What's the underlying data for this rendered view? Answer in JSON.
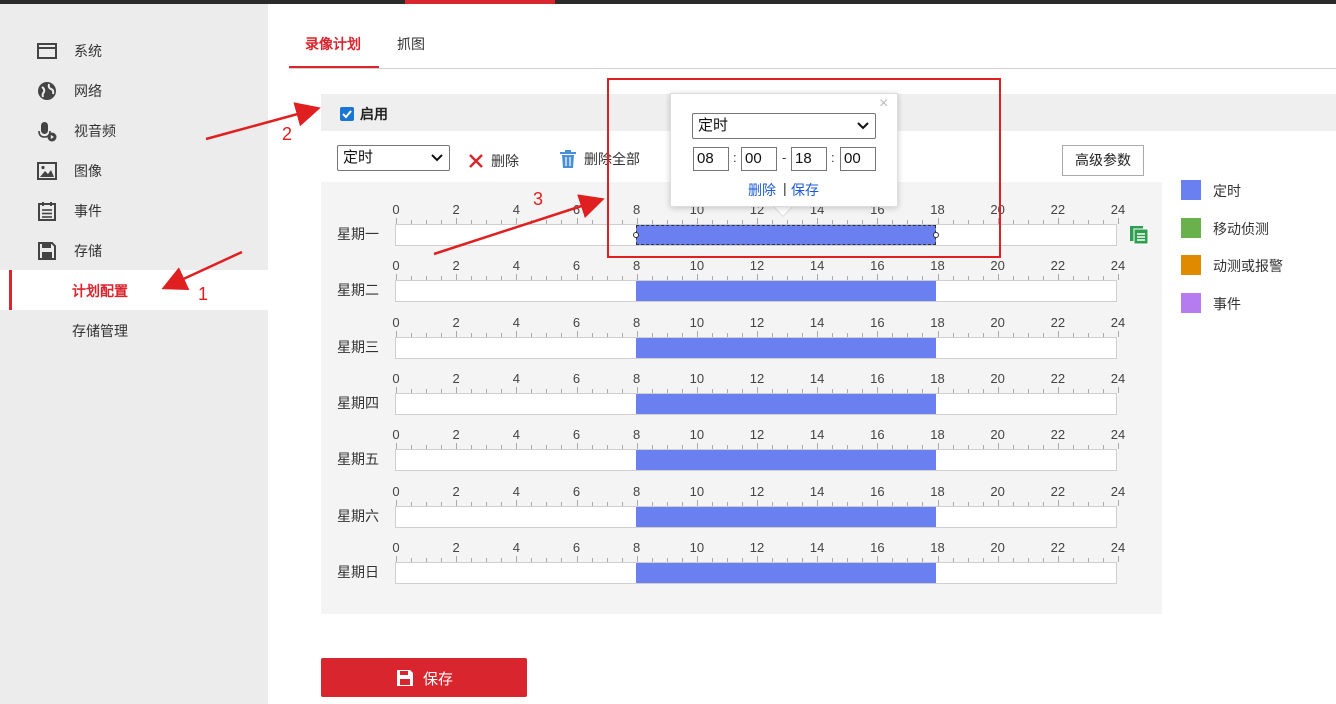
{
  "sidebar": {
    "items": [
      {
        "label": "系统",
        "icon": "system-window-icon"
      },
      {
        "label": "网络",
        "icon": "globe-icon"
      },
      {
        "label": "视音频",
        "icon": "microphone-icon"
      },
      {
        "label": "图像",
        "icon": "image-icon"
      },
      {
        "label": "事件",
        "icon": "calendar-icon"
      },
      {
        "label": "存储",
        "icon": "floppy-disk-icon"
      }
    ],
    "sub_items": [
      {
        "label": "计划配置",
        "active": true
      },
      {
        "label": "存储管理",
        "active": false
      }
    ]
  },
  "tabs": [
    {
      "label": "录像计划",
      "active": true
    },
    {
      "label": "抓图",
      "active": false
    }
  ],
  "enable": {
    "label": "启用",
    "checked": true
  },
  "toolbar": {
    "type_select": "定时",
    "delete_label": "删除",
    "delete_all_label": "删除全部",
    "advanced_label": "高级参数"
  },
  "schedule": {
    "hours": [
      "0",
      "2",
      "4",
      "6",
      "8",
      "10",
      "12",
      "14",
      "16",
      "18",
      "20",
      "22",
      "24"
    ],
    "days": [
      {
        "label": "星期一",
        "start": 8,
        "end": 18,
        "selected": true
      },
      {
        "label": "星期二",
        "start": 8,
        "end": 18,
        "selected": false
      },
      {
        "label": "星期三",
        "start": 8,
        "end": 18,
        "selected": false
      },
      {
        "label": "星期四",
        "start": 8,
        "end": 18,
        "selected": false
      },
      {
        "label": "星期五",
        "start": 8,
        "end": 18,
        "selected": false
      },
      {
        "label": "星期六",
        "start": 8,
        "end": 18,
        "selected": false
      },
      {
        "label": "星期日",
        "start": 8,
        "end": 18,
        "selected": false
      }
    ]
  },
  "legend": [
    {
      "label": "定时",
      "color": "#6a7ff0"
    },
    {
      "label": "移动侦测",
      "color": "#6ab04c"
    },
    {
      "label": "动测或报警",
      "color": "#e08a00"
    },
    {
      "label": "事件",
      "color": "#b57cf0"
    }
  ],
  "popup": {
    "type": "定时",
    "start_hour": "08",
    "start_min": "00",
    "end_hour": "18",
    "end_min": "00",
    "colon": ":",
    "dash": "-",
    "delete_label": "删除",
    "separator": "|",
    "save_label": "保存",
    "close": "×"
  },
  "annotations": {
    "n1": "1",
    "n2": "2",
    "n3": "3"
  },
  "save_button": {
    "label": "保存"
  }
}
